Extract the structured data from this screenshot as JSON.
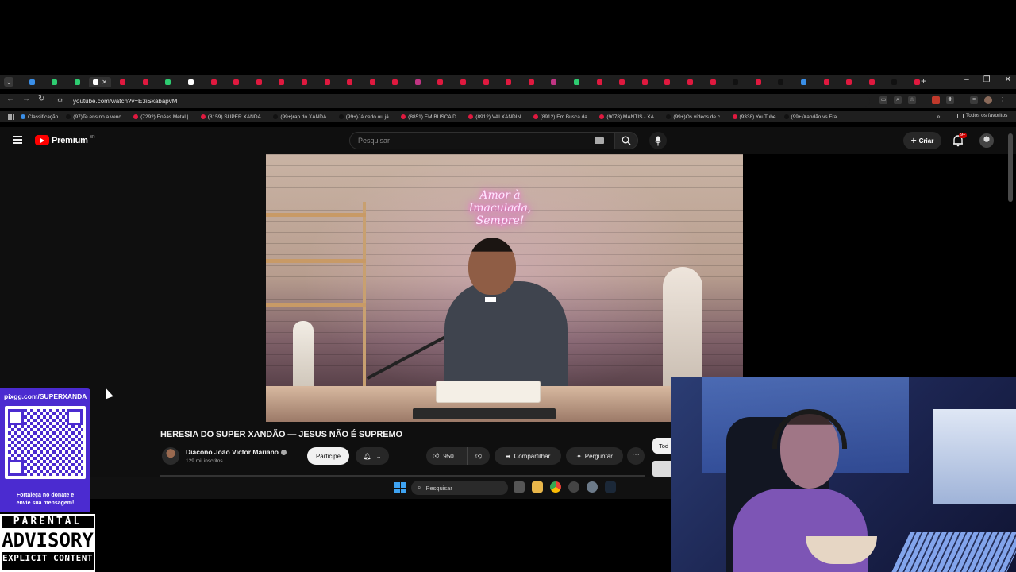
{
  "browser": {
    "url": "youtube.com/watch?v=E3iSxabapvM",
    "tab_favicon_colors": [
      "#3a8fe8",
      "#2ecc71",
      "#2ecc71",
      "#ffffff",
      "#e0193f",
      "#e0193f",
      "#2ecc71",
      "#ffffff",
      "#e0193f",
      "#e0193f",
      "#e0193f",
      "#e0193f",
      "#e0193f",
      "#e0193f",
      "#e0193f",
      "#e0193f",
      "#e0193f",
      "#c13584",
      "#e0193f",
      "#e0193f",
      "#e0193f",
      "#e0193f",
      "#e0193f",
      "#c13584",
      "#2ecc71",
      "#e0193f",
      "#e0193f",
      "#e0193f",
      "#e0193f",
      "#e0193f",
      "#e0193f",
      "#111111",
      "#e0193f",
      "#111111",
      "#3a8fe8",
      "#e0193f",
      "#e0193f",
      "#e0193f",
      "#111111",
      "#e0193f"
    ],
    "bookmarks": [
      {
        "label": "Classificação",
        "color": "#3a8fe8"
      },
      {
        "label": "(97)Te ensino a venc...",
        "color": "#111111"
      },
      {
        "label": "(7292) Enéas Metal |...",
        "color": "#e0193f"
      },
      {
        "label": "(8159) SUPER XANDÃ...",
        "color": "#e0193f"
      },
      {
        "label": "(99+)rap do XANDÃ...",
        "color": "#111111"
      },
      {
        "label": "(99+)Já cedo ou já...",
        "color": "#111111"
      },
      {
        "label": "(8851) EM BUSCA D...",
        "color": "#e0193f"
      },
      {
        "label": "(8912) VAI XANDIN...",
        "color": "#e0193f"
      },
      {
        "label": "(8912) Em Busca da...",
        "color": "#e0193f"
      },
      {
        "label": "(9078) MANTIS - XA...",
        "color": "#e0193f"
      },
      {
        "label": "(99+)Os vídeos de c...",
        "color": "#111111"
      },
      {
        "label": "(9338) YouTube",
        "color": "#e0193f"
      },
      {
        "label": "(99+)Xandão vs Fra...",
        "color": "#111111"
      }
    ],
    "bookmarks_more": "»",
    "all_bookmarks": "Todos os favoritos"
  },
  "youtube": {
    "logo_text": "Premium",
    "logo_country": "BR",
    "search_placeholder": "Pesquisar",
    "create_label": "Criar",
    "notifications_badge": "9+",
    "video": {
      "neon_text_line1": "Amor à Imaculada,",
      "neon_text_line2": "Sempre!"
    },
    "title": "HERESIA DO SUPER XANDÃO — JESUS NÃO É SUPREMO",
    "channel": {
      "name": "Diácono João Victor Mariano",
      "subscribers": "129 mil inscritos"
    },
    "join_label": "Participe",
    "likes": "950",
    "share_label": "Compartilhar",
    "ask_label": "Perguntar",
    "more_label": "⋯",
    "chip_label": "Tod"
  },
  "taskbar": {
    "search_placeholder": "Pesquisar"
  },
  "overlay": {
    "donate_url": "pixgg.com/SUPERXANDA",
    "donate_message_1": "Fortaleça no donate e",
    "donate_message_2": "envie sua mensagem!",
    "advisory_1": "PARENTAL",
    "advisory_2": "ADVISORY",
    "advisory_3": "EXPLICIT CONTENT"
  }
}
